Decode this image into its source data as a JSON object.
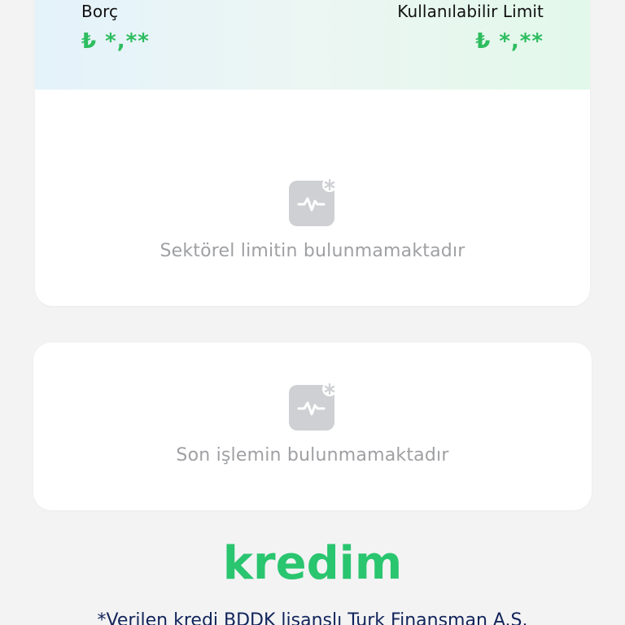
{
  "summary": {
    "debt_label": "Borç",
    "debt_value": "₺ *,**",
    "limit_label": "Kullanılabilir Limit",
    "limit_value": "₺ *,**"
  },
  "sector_limit": {
    "icon": "activity-icon",
    "empty_text": "Sektörel limitin bulunmamaktadır"
  },
  "transactions": {
    "icon": "activity-icon",
    "empty_text": "Son işlemin bulunmamaktadır"
  },
  "brand": {
    "name": "kredim",
    "color": "#2ac56f"
  },
  "footer": {
    "disclaimer": "*Verilen kredi BDDK lisanslı Turk Finansman A.Ş."
  },
  "colors": {
    "amount_green": "#2ebd5f",
    "muted_text": "#9fa0a3",
    "icon_gray": "#cfd0d3",
    "footer_navy": "#12245a"
  }
}
